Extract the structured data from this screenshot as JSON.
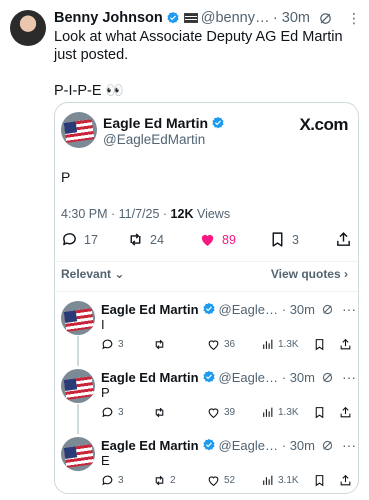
{
  "tweet": {
    "author_name": "Benny Johnson",
    "author_handle": "@bennyjoh...",
    "time": "· 30m",
    "lines": [
      "Look at what Associate Deputy AG Ed Martin just posted.",
      "P-I-P-E 👀"
    ]
  },
  "quote": {
    "author_name": "Eagle Ed Martin",
    "author_handle": "@EagleEdMartin",
    "source_label": "X.com",
    "body": "P",
    "timestamp": "4:30 PM · 11/7/25 · ",
    "views_count": "12K",
    "views_label": " Views",
    "actions": {
      "replies": "17",
      "reposts": "24",
      "likes": "89",
      "bookmarks": "3"
    },
    "like_color": "#f91880",
    "sort_label": "Relevant",
    "view_quotes_label": "View quotes"
  },
  "replies": [
    {
      "author_name": "Eagle Ed Martin",
      "author_handle": "@EagleEd...",
      "time": "· 30m",
      "text": "I",
      "replies": "3",
      "reposts": "",
      "likes": "36",
      "views": "1.3K"
    },
    {
      "author_name": "Eagle Ed Martin",
      "author_handle": "@EagleEd...",
      "time": "· 30m",
      "text": "P",
      "replies": "3",
      "reposts": "",
      "likes": "39",
      "views": "1.3K"
    },
    {
      "author_name": "Eagle Ed Martin",
      "author_handle": "@EagleEd...",
      "time": "· 30m",
      "text": "E",
      "replies": "3",
      "reposts": "2",
      "likes": "52",
      "views": "3.1K"
    }
  ],
  "colors": {
    "verified": "#1d9bf0",
    "text": "#0f1419",
    "muted": "#536471",
    "border": "#cfd9de"
  }
}
